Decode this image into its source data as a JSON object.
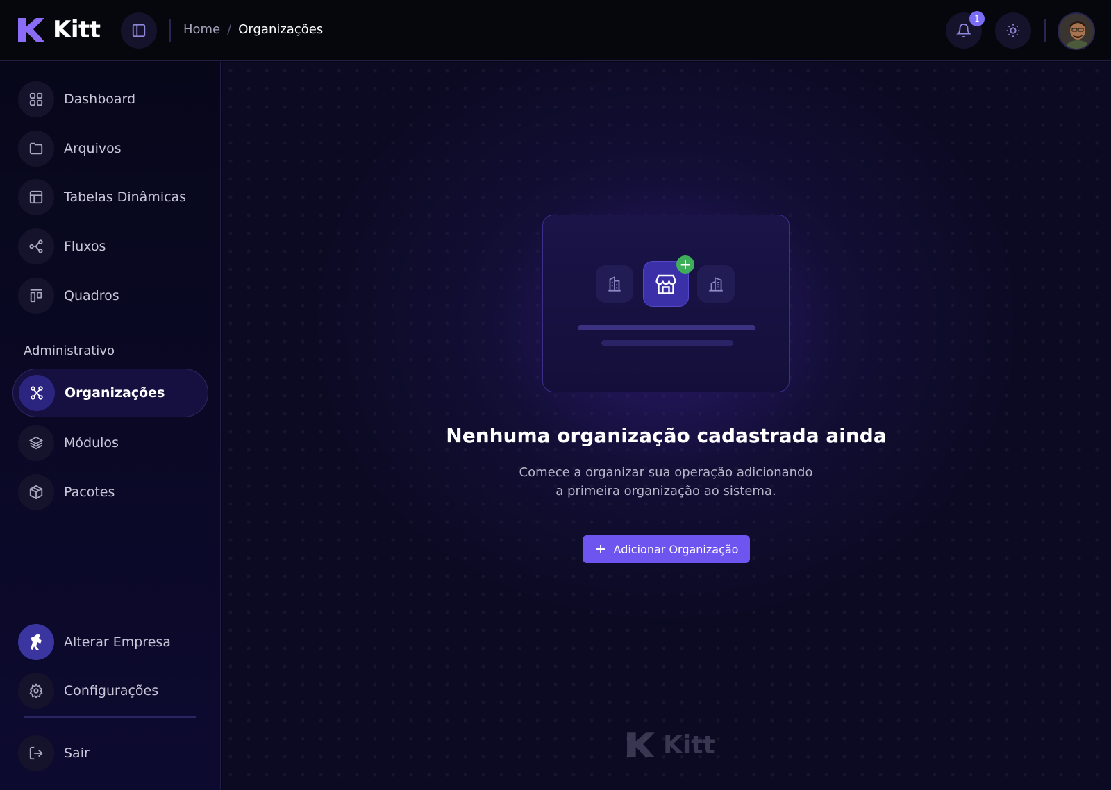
{
  "header": {
    "brand": "Kitt",
    "breadcrumb": {
      "home": "Home",
      "separator": "/",
      "current": "Organizações"
    },
    "notification_count": "1"
  },
  "sidebar": {
    "items": [
      {
        "label": "Dashboard",
        "icon": "grid-icon"
      },
      {
        "label": "Arquivos",
        "icon": "folder-icon"
      },
      {
        "label": "Tabelas Dinâmicas",
        "icon": "table-icon"
      },
      {
        "label": "Fluxos",
        "icon": "flow-icon"
      },
      {
        "label": "Quadros",
        "icon": "kanban-icon"
      }
    ],
    "section_label": "Administrativo",
    "admin_items": [
      {
        "label": "Organizações",
        "icon": "network-icon",
        "active": true
      },
      {
        "label": "Módulos",
        "icon": "layers-icon"
      },
      {
        "label": "Pacotes",
        "icon": "package-icon"
      }
    ],
    "bottom_items": [
      {
        "label": "Alterar Empresa",
        "icon": "company-logo-icon"
      },
      {
        "label": "Configurações",
        "icon": "gear-icon"
      },
      {
        "label": "Sair",
        "icon": "logout-icon"
      }
    ]
  },
  "empty_state": {
    "title": "Nenhuma organização cadastrada ainda",
    "description_line1": "Comece a organizar sua operação adicionando",
    "description_line2": "a primeira organização ao sistema.",
    "button_label": "Adicionar Organização",
    "plus_symbol": "+"
  },
  "footer": {
    "watermark": "Kitt"
  },
  "colors": {
    "accent": "#6f55f0",
    "active_bg": "#151040",
    "success": "#3fae5a",
    "badge": "#7b6cf6"
  }
}
